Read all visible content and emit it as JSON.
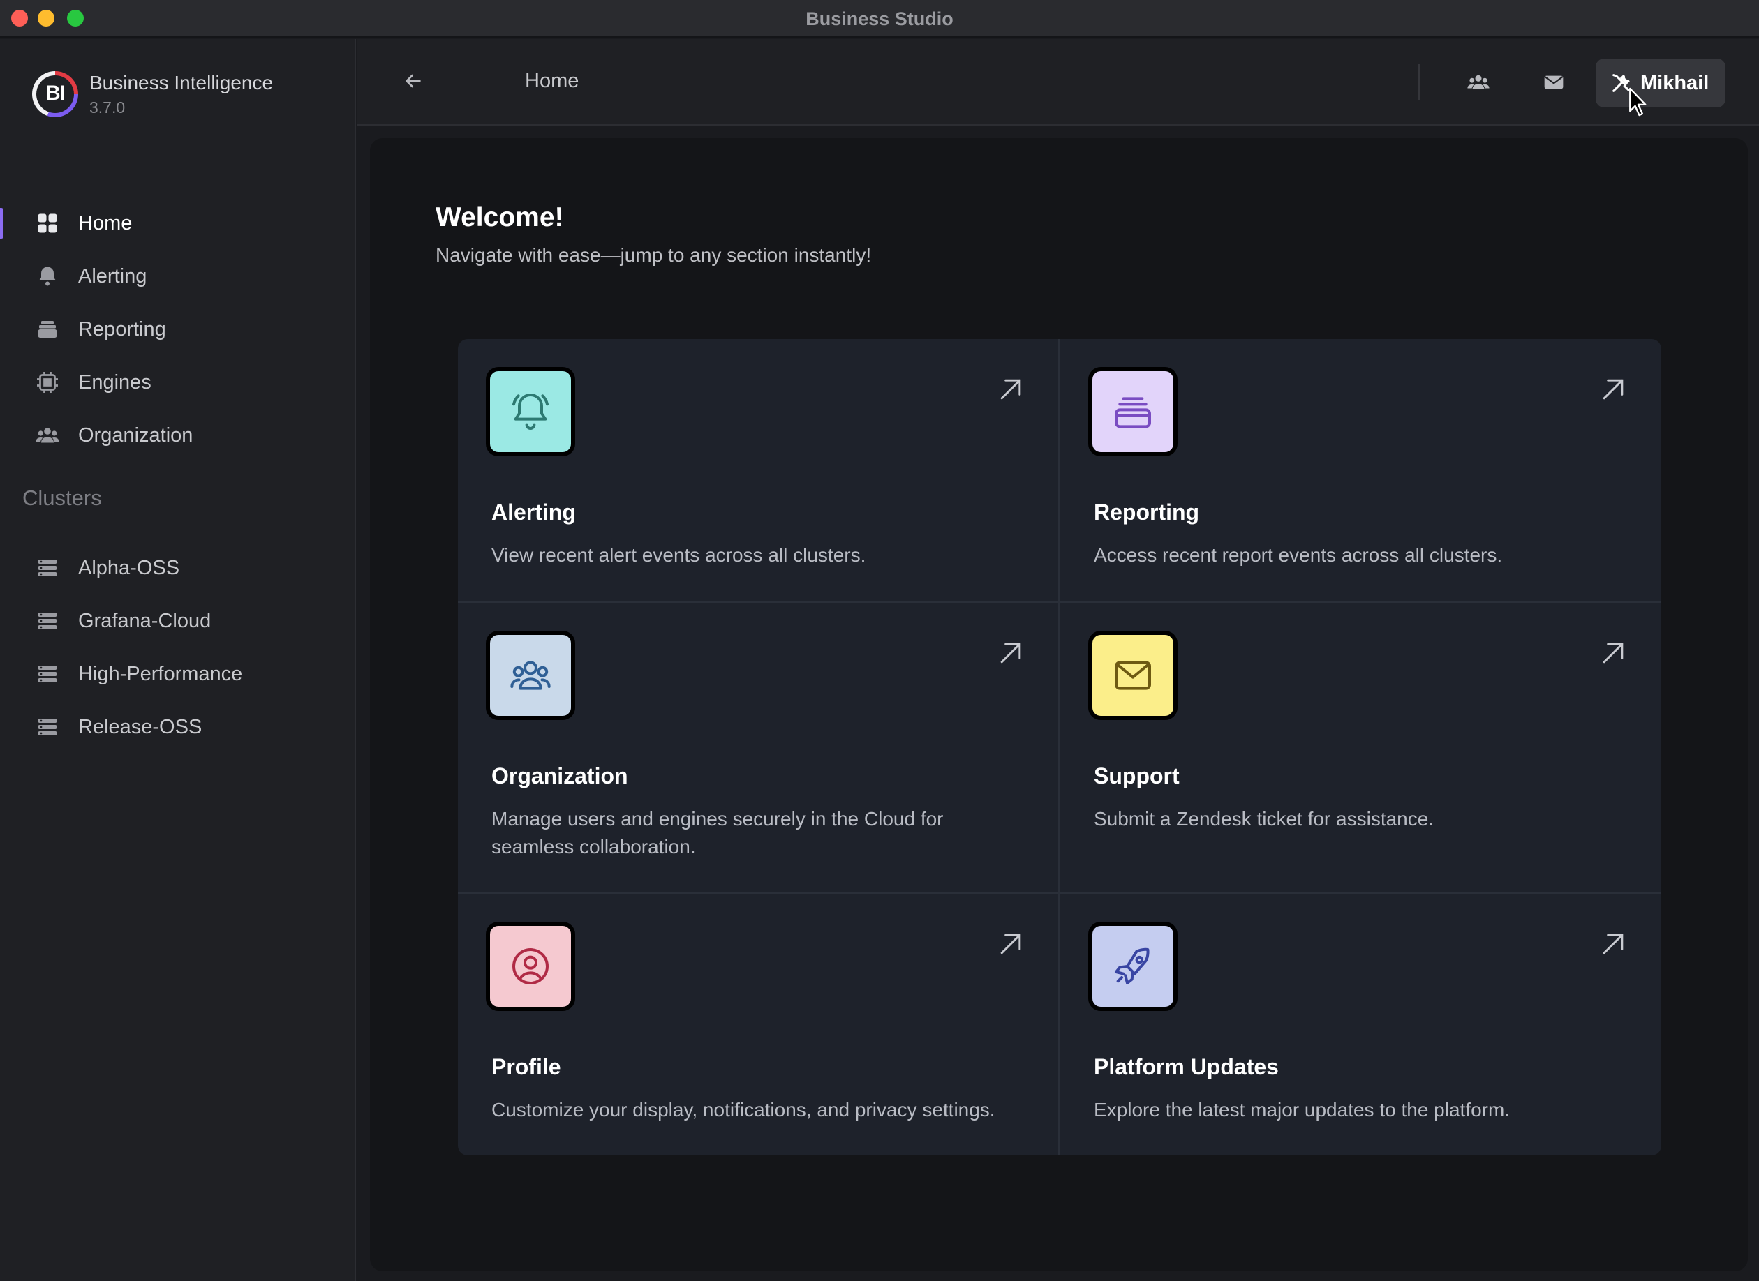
{
  "window": {
    "title": "Business Studio"
  },
  "sidebar": {
    "brand_logo_text": "BI",
    "brand_name": "Business Intelligence",
    "brand_version": "3.7.0",
    "nav": [
      {
        "label": "Home",
        "icon": "grid-icon",
        "active": true
      },
      {
        "label": "Alerting",
        "icon": "bell-icon"
      },
      {
        "label": "Reporting",
        "icon": "stack-icon"
      },
      {
        "label": "Engines",
        "icon": "chip-icon"
      },
      {
        "label": "Organization",
        "icon": "users-icon"
      }
    ],
    "clusters_label": "Clusters",
    "clusters": [
      {
        "label": "Alpha-OSS",
        "icon": "server-icon"
      },
      {
        "label": "Grafana-Cloud",
        "icon": "server-icon"
      },
      {
        "label": "High-Performance",
        "icon": "server-icon"
      },
      {
        "label": "Release-OSS",
        "icon": "server-icon"
      }
    ]
  },
  "header": {
    "title": "Home",
    "user_name": "Mikhail"
  },
  "main": {
    "welcome_title": "Welcome!",
    "welcome_subtitle": "Navigate with ease—jump to any section instantly!",
    "cards": [
      {
        "title": "Alerting",
        "description": "View recent alert events across all clusters.",
        "icon": "bell-icon",
        "color": "#9be9e4"
      },
      {
        "title": "Reporting",
        "description": "Access recent report events across all clusters.",
        "icon": "stack-icon",
        "color": "#e2d4fa"
      },
      {
        "title": "Organization",
        "description": "Manage users and engines securely in the Cloud for seamless collaboration.",
        "icon": "users-icon",
        "color": "#c9d9ea"
      },
      {
        "title": "Support",
        "description": "Submit a Zendesk ticket for assistance.",
        "icon": "mail-icon",
        "color": "#fbee8a"
      },
      {
        "title": "Profile",
        "description": "Customize your display, notifications, and privacy settings.",
        "icon": "user-circle-icon",
        "color": "#f5c9d0"
      },
      {
        "title": "Platform Updates",
        "description": "Explore the latest major updates to the platform.",
        "icon": "rocket-icon",
        "color": "#c5cdf0"
      }
    ]
  },
  "colors": {
    "accent": "#8b6cf2",
    "card_bg": "#1e222b"
  }
}
